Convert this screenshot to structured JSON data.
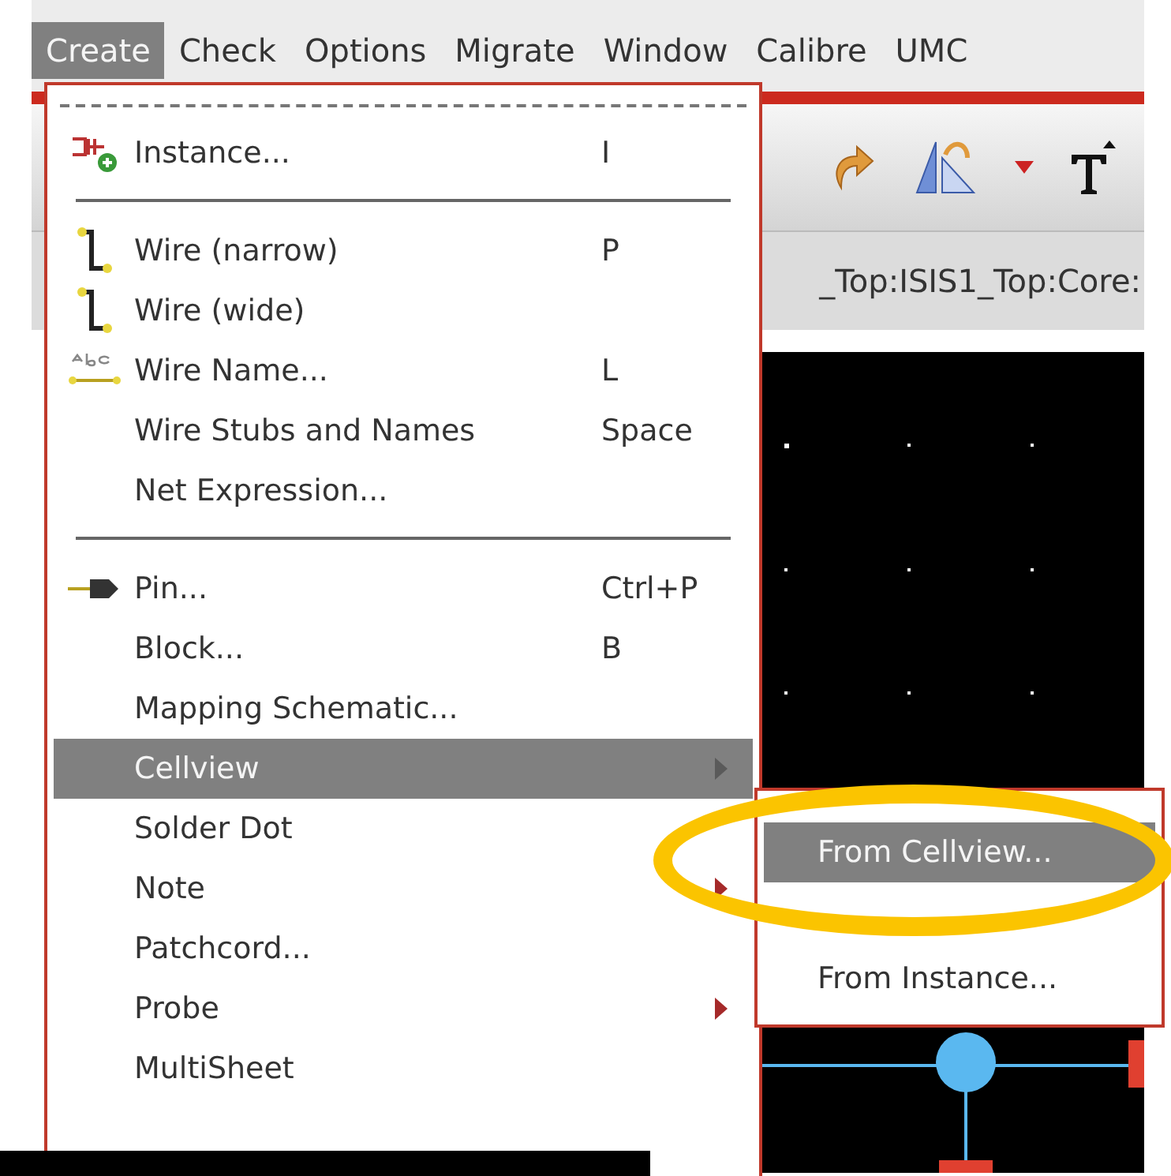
{
  "menubar": [
    {
      "label": "Create",
      "selected": true
    },
    {
      "label": "Check",
      "selected": false
    },
    {
      "label": "Options",
      "selected": false
    },
    {
      "label": "Migrate",
      "selected": false
    },
    {
      "label": "Window",
      "selected": false
    },
    {
      "label": "Calibre",
      "selected": false
    },
    {
      "label": "UMC",
      "selected": false
    }
  ],
  "path_bar": {
    "text": "_Top:ISIS1_Top:Core:"
  },
  "menu": {
    "items": [
      {
        "kind": "tearoff"
      },
      {
        "kind": "item",
        "label": "Instance...",
        "shortcut": "I",
        "selected": false,
        "submenu": false
      },
      {
        "kind": "separator"
      },
      {
        "kind": "item",
        "label": "Wire (narrow)",
        "shortcut": "P",
        "selected": false,
        "submenu": false
      },
      {
        "kind": "item",
        "label": "Wire (wide)",
        "selected": false,
        "submenu": false
      },
      {
        "kind": "item",
        "label": "Wire Name...",
        "shortcut": "L",
        "selected": false,
        "submenu": false
      },
      {
        "kind": "item",
        "label": "Wire Stubs and Names",
        "shortcut": "Space",
        "selected": false,
        "submenu": false
      },
      {
        "kind": "item",
        "label": "Net Expression...",
        "selected": false,
        "submenu": false
      },
      {
        "kind": "separator"
      },
      {
        "kind": "item",
        "label": "Pin...",
        "shortcut": "Ctrl+P",
        "selected": false,
        "submenu": false
      },
      {
        "kind": "item",
        "label": "Block...",
        "shortcut": "B",
        "selected": false,
        "submenu": false
      },
      {
        "kind": "item",
        "label": "Mapping Schematic...",
        "selected": false,
        "submenu": false
      },
      {
        "kind": "item",
        "label": "Cellview",
        "selected": true,
        "submenu": true
      },
      {
        "kind": "item",
        "label": "Solder Dot",
        "selected": false,
        "submenu": false
      },
      {
        "kind": "item",
        "label": "Note",
        "selected": false,
        "submenu": true
      },
      {
        "kind": "item",
        "label": "Patchcord...",
        "selected": false,
        "submenu": false
      },
      {
        "kind": "item",
        "label": "Probe",
        "selected": false,
        "submenu": true
      },
      {
        "kind": "item",
        "label": "MultiSheet",
        "selected": false,
        "submenu": false
      }
    ]
  },
  "submenu": {
    "items": [
      {
        "kind": "covered"
      },
      {
        "kind": "item",
        "label": "From Cellview...",
        "selected": true
      },
      {
        "kind": "covered"
      },
      {
        "kind": "item",
        "label": "From Instance...",
        "selected": false
      }
    ]
  }
}
